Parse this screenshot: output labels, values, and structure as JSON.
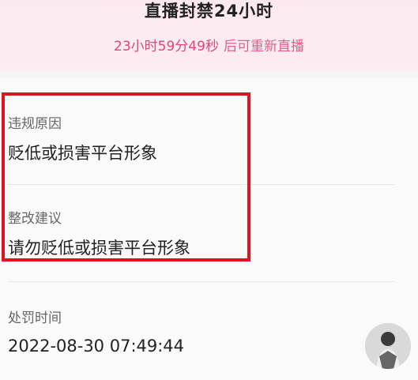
{
  "banner": {
    "title": "直播封禁24小时",
    "countdown": "23小时59分49秒",
    "after_text": "后可重新直播"
  },
  "details": {
    "violation_reason_label": "违规原因",
    "violation_reason_value": "贬低或损害平台形象",
    "rectification_label": "整改建议",
    "rectification_value": "请勿贬低或损害平台形象",
    "penalty_time_label": "处罚时间",
    "penalty_time_value": "2022-08-30 07:49:44"
  },
  "colors": {
    "accent": "#e0457a",
    "highlight_border": "#e0141e"
  },
  "icons": {
    "avatar": "user-avatar-icon"
  }
}
